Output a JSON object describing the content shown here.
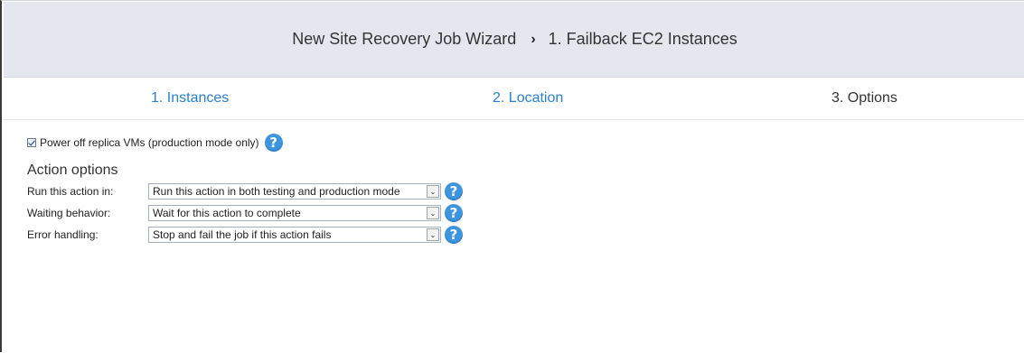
{
  "header": {
    "wizard_title": "New Site Recovery Job Wizard",
    "separator": "›",
    "step_title": "1. Failback EC2 Instances"
  },
  "steps": [
    {
      "label": "1. Instances",
      "state": "link"
    },
    {
      "label": "2. Location",
      "state": "link"
    },
    {
      "label": "3. Options",
      "state": "current"
    }
  ],
  "options": {
    "power_off": {
      "label": "Power off replica VMs (production mode only)",
      "checked": true
    },
    "section_title": "Action options",
    "rows": [
      {
        "label": "Run this action in:",
        "value": "Run this action in both testing and production mode"
      },
      {
        "label": "Waiting behavior:",
        "value": "Wait for this action to complete"
      },
      {
        "label": "Error handling:",
        "value": "Stop and fail the job if this action fails"
      }
    ]
  },
  "icons": {
    "help": "question-mark-icon",
    "dropdown": "chevron-down-icon",
    "help_glyph": "?",
    "dropdown_glyph": "⌄"
  },
  "colors": {
    "link": "#2a7fcf",
    "header_bg": "#e4e8ee",
    "help_icon": "#3d95e0"
  }
}
